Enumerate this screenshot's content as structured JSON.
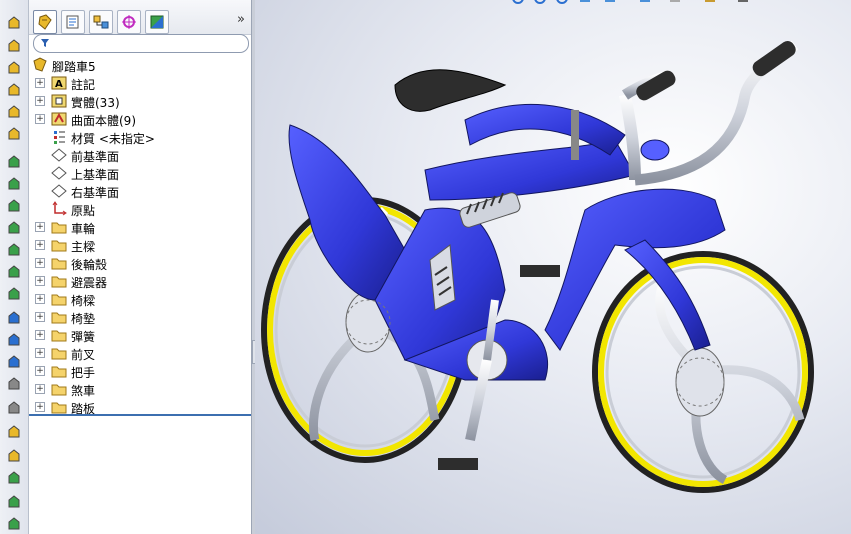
{
  "tree": {
    "root_label": "腳踏車5",
    "items": [
      {
        "label": "註記",
        "expandable": true,
        "icon": "annotations-icon"
      },
      {
        "label": "實體(33)",
        "expandable": true,
        "icon": "solid-bodies-icon"
      },
      {
        "label": "曲面本體(9)",
        "expandable": true,
        "icon": "surface-bodies-icon"
      },
      {
        "label": "材質 <未指定>",
        "expandable": false,
        "icon": "material-icon"
      },
      {
        "label": "前基準面",
        "expandable": false,
        "icon": "plane-icon"
      },
      {
        "label": "上基準面",
        "expandable": false,
        "icon": "plane-icon"
      },
      {
        "label": "右基準面",
        "expandable": false,
        "icon": "plane-icon"
      },
      {
        "label": "原點",
        "expandable": false,
        "icon": "origin-icon"
      },
      {
        "label": "車輪",
        "expandable": true,
        "icon": "folder-icon"
      },
      {
        "label": "主樑",
        "expandable": true,
        "icon": "folder-icon"
      },
      {
        "label": "後輪殼",
        "expandable": true,
        "icon": "folder-icon"
      },
      {
        "label": "避震器",
        "expandable": true,
        "icon": "folder-icon"
      },
      {
        "label": "椅樑",
        "expandable": true,
        "icon": "folder-icon"
      },
      {
        "label": "椅墊",
        "expandable": true,
        "icon": "folder-icon"
      },
      {
        "label": "彈簧",
        "expandable": true,
        "icon": "folder-icon"
      },
      {
        "label": "前叉",
        "expandable": true,
        "icon": "folder-icon"
      },
      {
        "label": "把手",
        "expandable": true,
        "icon": "folder-icon"
      },
      {
        "label": "煞車",
        "expandable": true,
        "icon": "folder-icon"
      },
      {
        "label": "踏板",
        "expandable": true,
        "icon": "folder-icon"
      }
    ]
  },
  "tabs": [
    "feature-manager-tab",
    "property-manager-tab",
    "configuration-manager-tab",
    "dimxpert-tab",
    "display-manager-tab"
  ],
  "colors": {
    "frame": "#3a45e0",
    "rim": "#f2e600",
    "background": "#dfe3ec"
  }
}
